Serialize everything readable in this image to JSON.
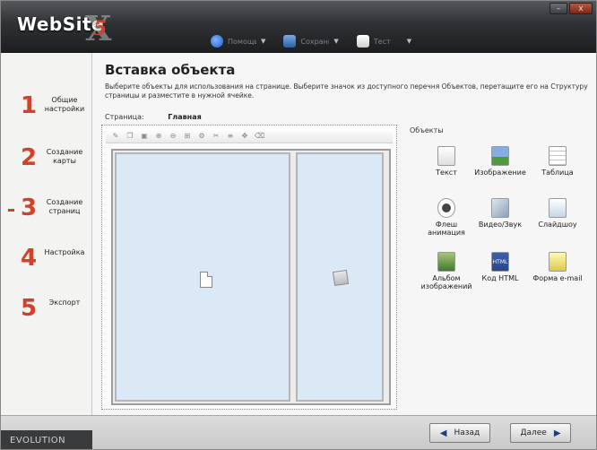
{
  "app": {
    "logo_text": "WebSite",
    "logo_version": "5",
    "logo_mark": "X",
    "edition": "EVOLUTION"
  },
  "menubar": {
    "items": [
      {
        "icon": "help-icon",
        "label": "Помощь"
      },
      {
        "icon": "save-icon",
        "label": "Сохранить"
      },
      {
        "icon": "file-icon",
        "label": "Тест"
      }
    ]
  },
  "window_controls": {
    "minimize": "–",
    "close": "x"
  },
  "steps": [
    {
      "num": "1",
      "label": "Общие настройки",
      "active": false
    },
    {
      "num": "2",
      "label": "Создание карты",
      "active": false
    },
    {
      "num": "3",
      "label": "Создание страниц",
      "active": true
    },
    {
      "num": "4",
      "label": "Настройка",
      "active": false
    },
    {
      "num": "5",
      "label": "Экспорт",
      "active": false
    }
  ],
  "content": {
    "title": "Вставка объекта",
    "description": "Выберите объекты для использования на странице. Выберите значок из доступного перечня Объектов, перетащите его на Структуру страницы и разместите в нужной ячейке.",
    "page_label": "Страница:",
    "page_value": "Главная"
  },
  "objects": {
    "title": "Объекты",
    "items": [
      {
        "label": "Текст",
        "icon": "text-object-icon"
      },
      {
        "label": "Изображение",
        "icon": "image-object-icon"
      },
      {
        "label": "Таблица",
        "icon": "table-object-icon"
      },
      {
        "label": "Флеш анимация",
        "icon": "flash-object-icon"
      },
      {
        "label": "Видео/Звук",
        "icon": "video-object-icon"
      },
      {
        "label": "Слайдшоу",
        "icon": "slideshow-object-icon"
      },
      {
        "label": "Альбом изображений",
        "icon": "album-object-icon"
      },
      {
        "label": "Код HTML",
        "icon": "html-object-icon",
        "icon_text": "HTML"
      },
      {
        "label": "Форма e-mail",
        "icon": "email-form-object-icon"
      }
    ]
  },
  "nav": {
    "back_label": "Назад",
    "next_label": "Далее"
  }
}
